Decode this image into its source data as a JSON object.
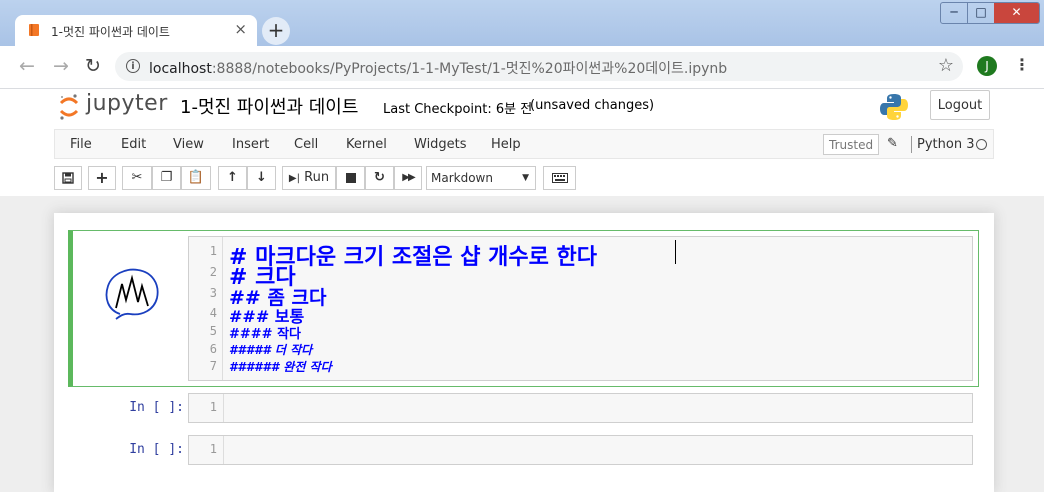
{
  "browser": {
    "tab_title": "1-멋진 파이썬과 데이트",
    "tab_close": "×",
    "new_tab": "+",
    "url_host": "localhost",
    "url_rest": ":8888/notebooks/PyProjects/1-1-MyTest/1-멋진%20파이썬과%20데이트.ipynb",
    "profile_initial": "J",
    "window_buttons": [
      "─",
      "□",
      "✕"
    ]
  },
  "header": {
    "wordmark": "jupyter",
    "notebook_name": "1-멋진 파이썬과 데이트",
    "checkpoint": "Last Checkpoint: 6분 전",
    "autosave": "(unsaved changes)",
    "logout_label": "Logout"
  },
  "menubar": {
    "items": [
      "File",
      "Edit",
      "View",
      "Insert",
      "Cell",
      "Kernel",
      "Widgets",
      "Help"
    ],
    "trusted_label": "Trusted",
    "kernel_name": "Python 3"
  },
  "toolbar": {
    "run_label": "Run",
    "cell_type": "Markdown"
  },
  "cells": {
    "markdown": {
      "lines": [
        "# 마크다운 크기 조절은 샵 개수로 한다",
        "# 크다",
        "## 좀 크다",
        "### 보통",
        "#### 작다",
        "##### 더 작다",
        "###### 완전 작다"
      ],
      "line_numbers": [
        "1",
        "2",
        "3",
        "4",
        "5",
        "6",
        "7"
      ]
    },
    "code": [
      {
        "prompt": "In [ ]:",
        "line_number": "1"
      },
      {
        "prompt": "In [ ]:",
        "line_number": "1"
      }
    ]
  },
  "colors": {
    "accent_green": "#5cb85c",
    "markdown_blue": "#0000ff",
    "prompt_blue": "#303f9f",
    "jupyter_orange": "#f37726"
  }
}
